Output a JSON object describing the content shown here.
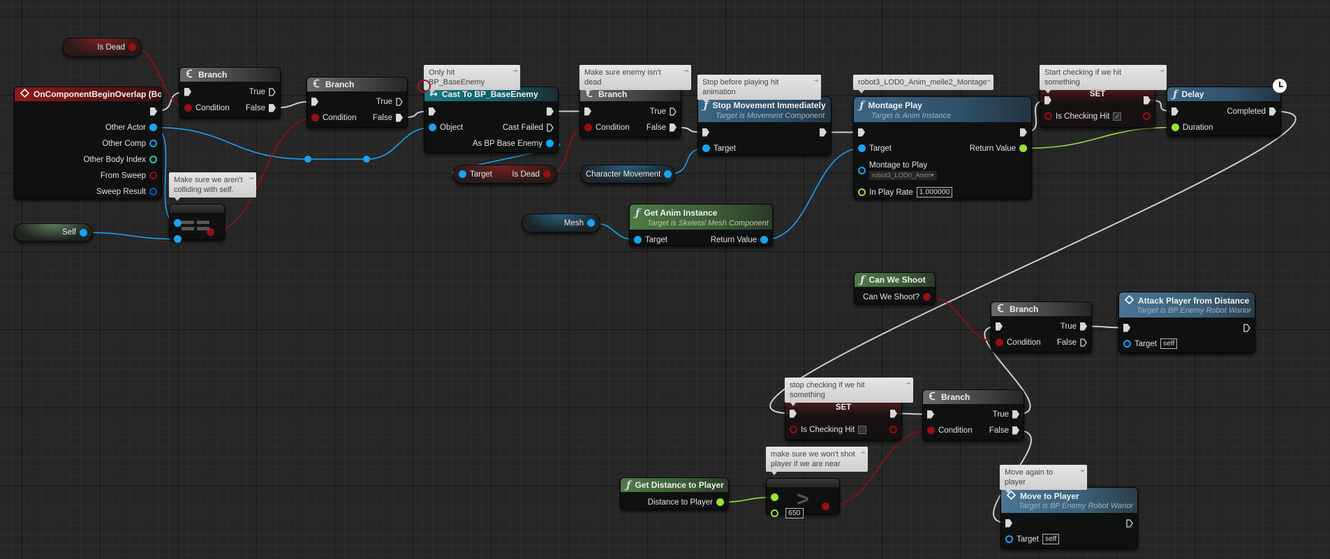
{
  "colors": {
    "exec": "#d8d8d8",
    "object": "#1aa3f0",
    "bool": "#9a0f0f",
    "float": "#9be03a",
    "int": "#2ed1a0",
    "struct": "#0a5bc0",
    "self_var": "#5f7a5f"
  },
  "nodes": [
    {
      "id": "ev",
      "kind": "event",
      "icon": "event-diamond-icon",
      "title": "OnComponentBeginOverlap (Box)",
      "rows": [
        {
          "r": {
            "type": "exec",
            "linked": true,
            "label": ""
          }
        },
        {
          "r": {
            "type": "object",
            "linked": true,
            "label": "Other Actor"
          }
        },
        {
          "r": {
            "type": "object",
            "linked": false,
            "label": "Other Comp"
          }
        },
        {
          "r": {
            "type": "int",
            "linked": false,
            "label": "Other Body Index"
          }
        },
        {
          "r": {
            "type": "bool",
            "linked": false,
            "label": "From Sweep"
          }
        },
        {
          "r": {
            "type": "struct",
            "linked": false,
            "label": "Sweep Result"
          }
        }
      ]
    },
    {
      "id": "br1",
      "kind": "branch",
      "icon": "branch-icon",
      "title": "Branch",
      "rows": [
        {
          "l": {
            "type": "exec",
            "linked": true,
            "label": ""
          },
          "r": {
            "type": "exec",
            "linked": false,
            "label": "True"
          }
        },
        {
          "l": {
            "type": "bool",
            "linked": true,
            "label": "Condition"
          },
          "r": {
            "type": "exec",
            "linked": true,
            "label": "False"
          }
        }
      ]
    },
    {
      "id": "br2",
      "kind": "branch",
      "icon": "branch-icon",
      "title": "Branch",
      "rows": [
        {
          "l": {
            "type": "exec",
            "linked": true,
            "label": ""
          },
          "r": {
            "type": "exec",
            "linked": false,
            "label": "True"
          }
        },
        {
          "l": {
            "type": "bool",
            "linked": true,
            "label": "Condition"
          },
          "r": {
            "type": "exec",
            "linked": true,
            "label": "False"
          }
        }
      ]
    },
    {
      "id": "cast",
      "kind": "cast",
      "icon": "cast-arrow-icon",
      "title": "Cast To BP_BaseEnemy",
      "rows": [
        {
          "l": {
            "type": "exec",
            "linked": true,
            "label": ""
          },
          "r": {
            "type": "exec",
            "linked": true,
            "label": ""
          }
        },
        {
          "l": {
            "type": "object",
            "linked": true,
            "label": "Object"
          },
          "r": {
            "type": "exec",
            "linked": false,
            "label": "Cast Failed"
          }
        },
        {
          "r": {
            "type": "object",
            "linked": true,
            "label": "As BP Base Enemy"
          }
        }
      ]
    },
    {
      "id": "br3",
      "kind": "branch",
      "icon": "branch-icon",
      "title": "Branch",
      "rows": [
        {
          "l": {
            "type": "exec",
            "linked": true,
            "label": ""
          },
          "r": {
            "type": "exec",
            "linked": false,
            "label": "True"
          }
        },
        {
          "l": {
            "type": "bool",
            "linked": true,
            "label": "Condition"
          },
          "r": {
            "type": "exec",
            "linked": true,
            "label": "False"
          }
        }
      ]
    },
    {
      "id": "stop",
      "kind": "func",
      "icon": "function-icon",
      "title": "Stop Movement Immediately",
      "subtitle": "Target is Movement Component",
      "rows": [
        {
          "l": {
            "type": "exec",
            "linked": true,
            "label": ""
          },
          "r": {
            "type": "exec",
            "linked": true,
            "label": ""
          }
        },
        {
          "l": {
            "type": "object",
            "linked": true,
            "label": "Target"
          }
        }
      ]
    },
    {
      "id": "mont",
      "kind": "func",
      "icon": "function-icon",
      "title": "Montage Play",
      "subtitle": "Target is Anim Instance",
      "rows": [
        {
          "l": {
            "type": "exec",
            "linked": true,
            "label": ""
          },
          "r": {
            "type": "exec",
            "linked": true,
            "label": ""
          }
        },
        {
          "l": {
            "type": "object",
            "linked": true,
            "label": "Target"
          },
          "r": {
            "type": "float",
            "linked": true,
            "label": "Return Value"
          }
        },
        {
          "tall": true,
          "l": {
            "type": "object",
            "linked": false,
            "label": "Montage to Play",
            "dropdown": "robot3_LOD0_Anim▾"
          }
        },
        {
          "l": {
            "type": "float",
            "linked": false,
            "label": "In Play Rate",
            "value": "1.000000"
          }
        }
      ]
    },
    {
      "id": "gai",
      "kind": "pure",
      "icon": "function-icon",
      "title": "Get Anim Instance",
      "subtitle": "Target is Skeletal Mesh Component",
      "rows": [
        {
          "l": {
            "type": "object",
            "linked": true,
            "label": "Target"
          },
          "r": {
            "type": "object",
            "linked": true,
            "label": "Return Value"
          }
        }
      ]
    },
    {
      "id": "set1",
      "kind": "set",
      "title": "SET",
      "rows": [
        {
          "l": {
            "type": "exec",
            "linked": true,
            "label": ""
          },
          "r": {
            "type": "exec",
            "linked": true,
            "label": ""
          }
        },
        {
          "l": {
            "type": "bool",
            "linked": false,
            "label": "Is Checking Hit",
            "checkbox": true
          },
          "r": {
            "type": "bool",
            "linked": false,
            "label": ""
          }
        }
      ]
    },
    {
      "id": "delay",
      "kind": "func",
      "icon": "function-icon",
      "title": "Delay",
      "rows": [
        {
          "l": {
            "type": "exec",
            "linked": true,
            "label": ""
          },
          "r": {
            "type": "exec",
            "linked": true,
            "label": "Completed"
          }
        },
        {
          "l": {
            "type": "float",
            "linked": true,
            "label": "Duration"
          }
        }
      ]
    },
    {
      "id": "cws",
      "kind": "pure",
      "icon": "function-icon",
      "title": "Can We Shoot",
      "rows": [
        {
          "r": {
            "type": "bool",
            "linked": true,
            "label": "Can We Shoot?"
          }
        }
      ]
    },
    {
      "id": "br5",
      "kind": "branch",
      "icon": "branch-icon",
      "title": "Branch",
      "rows": [
        {
          "l": {
            "type": "exec",
            "linked": true,
            "label": ""
          },
          "r": {
            "type": "exec",
            "linked": true,
            "label": "True"
          }
        },
        {
          "l": {
            "type": "bool",
            "linked": true,
            "label": "Condition"
          },
          "r": {
            "type": "exec",
            "linked": false,
            "label": "False"
          }
        }
      ]
    },
    {
      "id": "atk",
      "kind": "call",
      "icon": "event-diamond-icon",
      "title": "Attack Player from Distance",
      "subtitle": "Target is BP Enemy Robot Warior",
      "rows": [
        {
          "l": {
            "type": "exec",
            "linked": true,
            "label": ""
          },
          "r": {
            "type": "exec",
            "linked": false,
            "label": ""
          }
        },
        {
          "l": {
            "type": "object",
            "linked": false,
            "label": "Target",
            "value": "self"
          }
        }
      ]
    },
    {
      "id": "set2",
      "kind": "set",
      "title": "SET",
      "rows": [
        {
          "l": {
            "type": "exec",
            "linked": true,
            "label": ""
          },
          "r": {
            "type": "exec",
            "linked": true,
            "label": ""
          }
        },
        {
          "l": {
            "type": "bool",
            "linked": false,
            "label": "Is Checking Hit",
            "checkbox": false
          },
          "r": {
            "type": "bool",
            "linked": false,
            "label": ""
          }
        }
      ]
    },
    {
      "id": "br4",
      "kind": "branch",
      "icon": "branch-icon",
      "title": "Branch",
      "rows": [
        {
          "l": {
            "type": "exec",
            "linked": true,
            "label": ""
          },
          "r": {
            "type": "exec",
            "linked": true,
            "label": "True"
          }
        },
        {
          "l": {
            "type": "bool",
            "linked": true,
            "label": "Condition"
          },
          "r": {
            "type": "exec",
            "linked": true,
            "label": "False"
          }
        }
      ]
    },
    {
      "id": "gd",
      "kind": "pure",
      "icon": "function-icon",
      "title": "Get Distance to Player",
      "rows": [
        {
          "r": {
            "type": "float",
            "linked": true,
            "label": "Distance to Player"
          }
        }
      ]
    },
    {
      "id": "move",
      "kind": "call",
      "icon": "event-diamond-icon",
      "title": "Move to Player",
      "subtitle": "Target is BP Enemy Robot Warior",
      "rows": [
        {
          "l": {
            "type": "exec",
            "linked": true,
            "label": ""
          },
          "r": {
            "type": "exec",
            "linked": false,
            "label": ""
          }
        },
        {
          "l": {
            "type": "object",
            "linked": false,
            "label": "Target",
            "value": "self"
          }
        }
      ]
    },
    {
      "id": "eq",
      "kind": "op",
      "symbol": "==",
      "rows": [
        {
          "l": {
            "type": "object",
            "linked": true,
            "label": ""
          }
        },
        {
          "l": {
            "type": "object",
            "linked": true,
            "label": ""
          },
          "r": {
            "type": "bool",
            "linked": true,
            "label": ""
          }
        }
      ]
    },
    {
      "id": "cmp",
      "kind": "op",
      "symbol": ">",
      "rows": [
        {
          "l": {
            "type": "float",
            "linked": true,
            "label": ""
          },
          "r": {
            "type": "bool",
            "linked": true,
            "label": ""
          }
        },
        {
          "l": {
            "type": "float",
            "linked": false,
            "label": "",
            "value": "650"
          }
        }
      ]
    }
  ],
  "variables": [
    {
      "id": "isdead",
      "style": "bool",
      "r": {
        "type": "bool",
        "label": "Is Dead"
      }
    },
    {
      "id": "self",
      "style": "selfp",
      "r": {
        "type": "object",
        "label": "Self"
      }
    },
    {
      "id": "tgt",
      "style": "bool",
      "l": {
        "type": "object",
        "label": "Target"
      },
      "r": {
        "type": "bool",
        "label": "Is Dead"
      }
    },
    {
      "id": "cm",
      "style": "obj",
      "r": {
        "type": "object",
        "label": "Character Movement"
      }
    },
    {
      "id": "mesh",
      "style": "obj",
      "r": {
        "type": "object",
        "label": "Mesh"
      }
    }
  ],
  "comments": [
    {
      "id": "c1",
      "text": "Make sure we aren't colliding with self."
    },
    {
      "id": "c2",
      "text": "Only hit BP_BaseEnemy"
    },
    {
      "id": "c3",
      "text": "Make sure enemy isn't dead"
    },
    {
      "id": "c4",
      "text": "Stop before playing hit animation"
    },
    {
      "id": "c5",
      "text": "robot3_LOD0_Anim_melle2_Montage"
    },
    {
      "id": "c6",
      "text": "Start checking if we hit something"
    },
    {
      "id": "c7",
      "text": "stop  checking if we hit something"
    },
    {
      "id": "c8",
      "text": "make sure we won't shot player if we are near"
    },
    {
      "id": "c9",
      "text": "Move again to player"
    }
  ]
}
